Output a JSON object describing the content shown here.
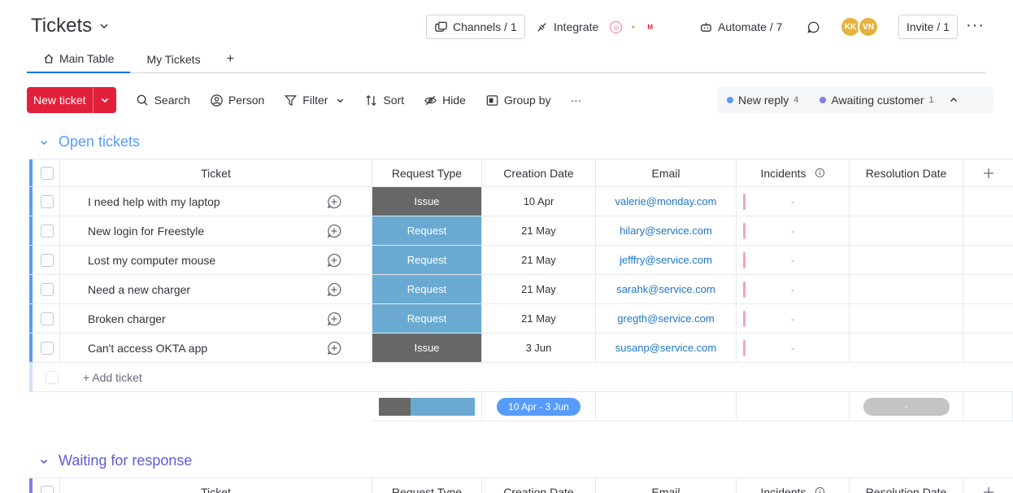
{
  "header": {
    "title": "Tickets",
    "channels": "Channels / 1",
    "integrate": "Integrate",
    "automate": "Automate / 7",
    "avatars": [
      "KK",
      "VN"
    ],
    "invite": "Invite / 1",
    "more": "···"
  },
  "tabs": [
    {
      "label": "Main Table",
      "active": true
    },
    {
      "label": "My Tickets",
      "active": false
    },
    {
      "label": "+"
    }
  ],
  "toolbar": {
    "new_ticket": "New ticket",
    "search": "Search",
    "person": "Person",
    "filter": "Filter",
    "sort": "Sort",
    "hide": "Hide",
    "group_by": "Group by",
    "more": "···"
  },
  "status_filters": [
    {
      "label": "New reply",
      "count": "4",
      "color": "#579bfc"
    },
    {
      "label": "Awaiting customer",
      "count": "1",
      "color": "#7f7fe0"
    }
  ],
  "columns": {
    "ticket": "Ticket",
    "request_type": "Request Type",
    "creation_date": "Creation Date",
    "email": "Email",
    "incidents": "Incidents",
    "resolution_date": "Resolution Date",
    "add": "+"
  },
  "groups": [
    {
      "title": "Open tickets",
      "color": "#579bfc",
      "add_label": "+ Add ticket",
      "rows": [
        {
          "ticket": "I need help with my laptop",
          "type": "Issue",
          "type_color": "#676767",
          "date": "10 Apr",
          "email": "valerie@monday.com",
          "incidents": "-"
        },
        {
          "ticket": "New login for Freestyle",
          "type": "Request",
          "type_color": "#6aaad2",
          "date": "21 May",
          "email": "hilary@service.com",
          "incidents": "-"
        },
        {
          "ticket": "Lost my computer mouse",
          "type": "Request",
          "type_color": "#6aaad2",
          "date": "21 May",
          "email": "jefffry@service.com",
          "incidents": "-"
        },
        {
          "ticket": "Need a new charger",
          "type": "Request",
          "type_color": "#6aaad2",
          "date": "21 May",
          "email": "sarahk@service.com",
          "incidents": "-"
        },
        {
          "ticket": "Broken charger",
          "type": "Request",
          "type_color": "#6aaad2",
          "date": "21 May",
          "email": "gregth@service.com",
          "incidents": "-"
        },
        {
          "ticket": "Can't access OKTA app",
          "type": "Issue",
          "type_color": "#676767",
          "date": "3 Jun",
          "email": "susanp@service.com",
          "incidents": "-"
        }
      ],
      "summary": {
        "type_share": [
          {
            "label": "Issue",
            "fraction": 0.333,
            "color": "#676767"
          },
          {
            "label": "Request",
            "fraction": 0.667,
            "color": "#6aaad2"
          }
        ],
        "date_range": "10 Apr - 3 Jun",
        "resolution": "-"
      }
    },
    {
      "title": "Waiting for response",
      "color": "#7f7fe0"
    }
  ]
}
